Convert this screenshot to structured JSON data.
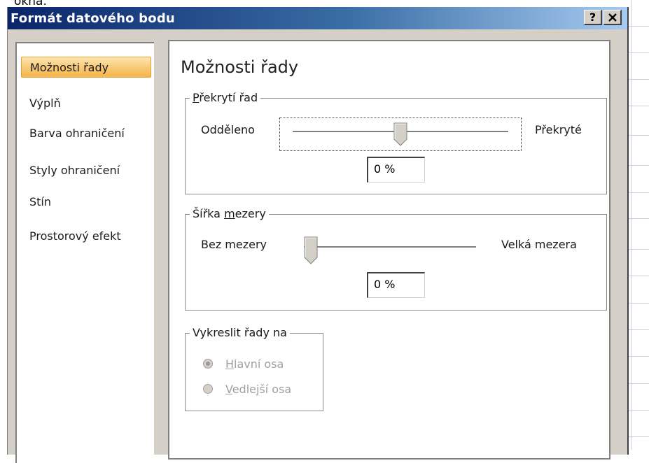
{
  "behind_text": "okna.",
  "dialog": {
    "title": "Formát datového bodu",
    "help_button": "?",
    "close_button": "✕"
  },
  "nav": {
    "items": [
      {
        "label": "Možnosti řady",
        "selected": true
      },
      {
        "label": "Výplň",
        "selected": false
      },
      {
        "label": "Barva ohraničení",
        "selected": false
      },
      {
        "label": "Styly ohraničení",
        "selected": false
      },
      {
        "label": "Stín",
        "selected": false
      },
      {
        "label": "Prostorový efekt",
        "selected": false
      }
    ]
  },
  "panel": {
    "title": "Možnosti řady",
    "overlap": {
      "legend_pre": "",
      "legend_accel": "P",
      "legend_post": "řekrytí řad",
      "left_label": "Odděleno",
      "right_label": "Překryté",
      "value": "0 %",
      "slider_fraction": 0.5
    },
    "gap": {
      "legend_pre": "Šířka ",
      "legend_accel": "m",
      "legend_post": "ezery",
      "left_label": "Bez mezery",
      "right_label": "Velká mezera",
      "value": "0 %",
      "slider_fraction": 0.0
    },
    "plot_on": {
      "legend": "Vykreslit řady na",
      "options": [
        {
          "accel": "H",
          "rest": "lavní osa",
          "checked": true
        },
        {
          "accel": "V",
          "rest": "edlejší osa",
          "checked": false
        }
      ],
      "disabled": true
    }
  },
  "colors": {
    "title_gradient_start": "#0a246a",
    "title_gradient_end": "#a6caf0",
    "dialog_face": "#d4d0c8",
    "selected_nav": "#f8c874"
  }
}
